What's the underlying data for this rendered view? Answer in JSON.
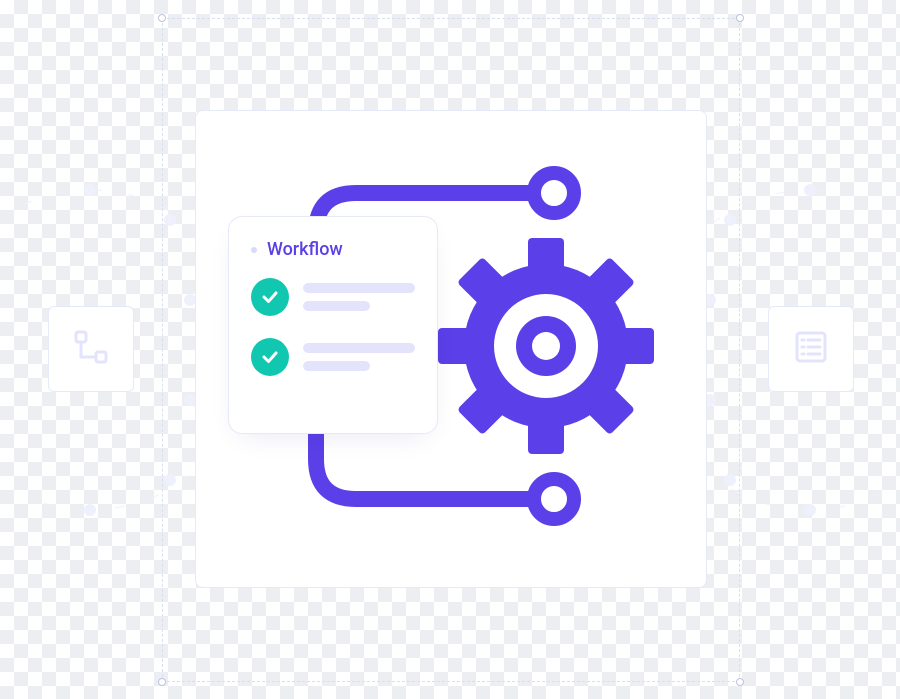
{
  "card": {
    "title": "Workflow"
  },
  "colors": {
    "accent": "#5B3FE8",
    "accent_light": "#e3e4fb",
    "check": "#12c7b0",
    "frame": "#e6e9f7",
    "ghost": "#eef1fb"
  },
  "icons": {
    "left": "branch-icon",
    "right": "server-icon",
    "main": "gear-icon",
    "item": "check-icon"
  }
}
